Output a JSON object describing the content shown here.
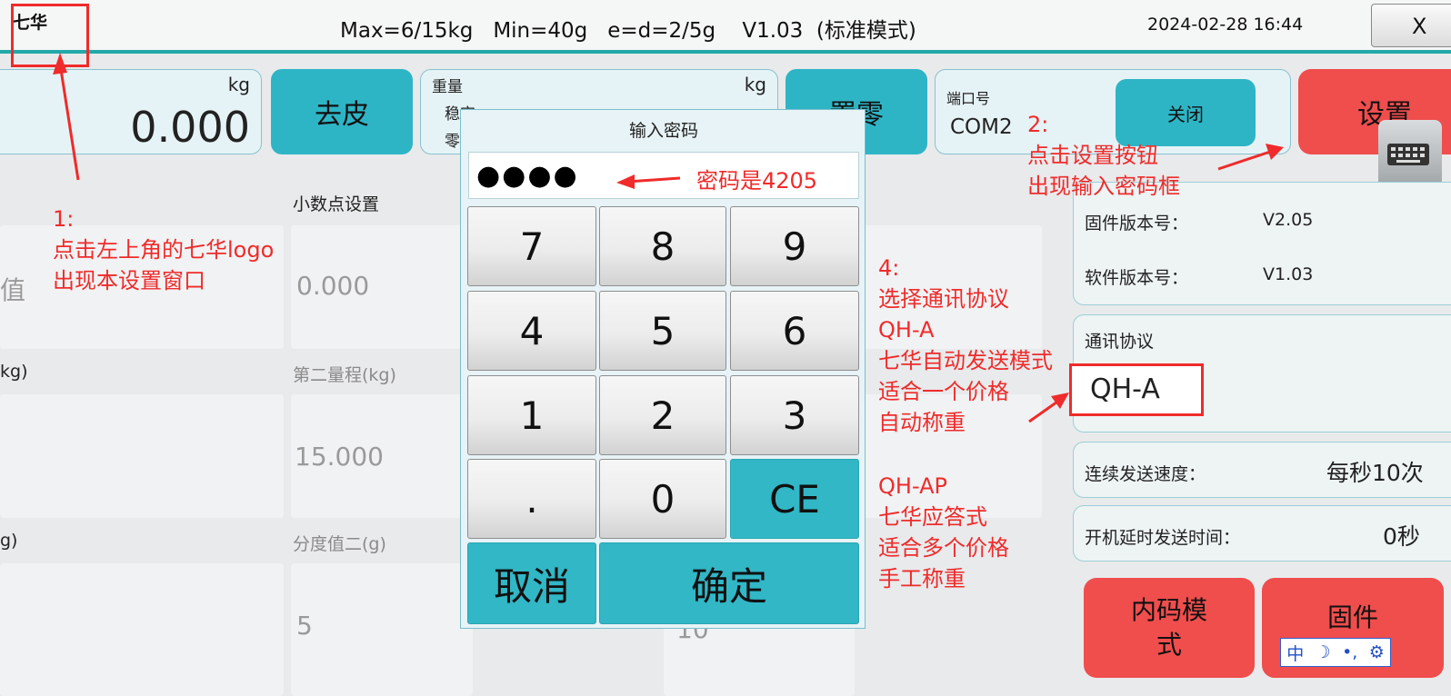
{
  "titlebar": {
    "logo": "七华",
    "spec": "Max=6/15kg   Min=40g   e=d=2/5g    V1.03  (标准模式)",
    "datetime": "2024-02-28 16:44",
    "close_label": "X"
  },
  "top": {
    "tare_panel": {
      "unit": "kg",
      "value": "0.000"
    },
    "tare_button": "去皮",
    "weight_panel": {
      "label": "重量",
      "unit": "kg",
      "row1": "稳定",
      "row2": "零"
    },
    "zero_button": "置零",
    "port_panel": {
      "label": "端口号",
      "value": "COM2",
      "close_button": "关闭"
    },
    "settings_button": "设置"
  },
  "settings": {
    "col1_label_a": "值",
    "col1_label_b": "kg)",
    "col1_label_c": "g)",
    "decimal_label": "小数点设置",
    "decimal_value": "0.000",
    "range2_label": "第二量程(kg)",
    "range2_value": "15.000",
    "division2_label": "分度值二(g)",
    "division2_value": "5",
    "col3_value": "10"
  },
  "right": {
    "firmware_label": "固件版本号：",
    "firmware_value": "V2.05",
    "software_label": "软件版本号：",
    "software_value": "V1.03",
    "protocol_label": "通讯协议",
    "protocol_value": "QH-A",
    "speed_label": "连续发送速度：",
    "speed_value": "每秒10次",
    "delay_label": "开机延时发送时间：",
    "delay_value": "0秒",
    "inner_code_button": "内码模式",
    "firmware_button": "固件"
  },
  "dialog": {
    "title": "输入密码",
    "password_mask": "●●●●",
    "keys": [
      "7",
      "8",
      "9",
      "4",
      "5",
      "6",
      "1",
      "2",
      "3",
      ".",
      "0",
      "CE"
    ],
    "cancel": "取消",
    "confirm": "确定"
  },
  "annotations": {
    "a1": [
      "1:",
      "点击左上角的七华logo",
      "出现本设置窗口"
    ],
    "a2": [
      "2:",
      "点击设置按钮",
      "出现输入密码框"
    ],
    "password_hint": "密码是4205",
    "a4": [
      "4:",
      "选择通讯协议",
      "QH-A",
      "七华自动发送模式",
      "适合一个价格",
      "自动称重"
    ],
    "a5": [
      "QH-AP",
      "七华应答式",
      "适合多个价格",
      "手工称重"
    ]
  },
  "ime": {
    "lang": "中",
    "moon": "☽",
    "punct": "•,",
    "gear": "⚙"
  },
  "colors": {
    "accent": "#23a9a9",
    "button_teal": "#2eb5c5",
    "button_red": "#f04d4d",
    "annotation_red": "#ef2b2b"
  }
}
